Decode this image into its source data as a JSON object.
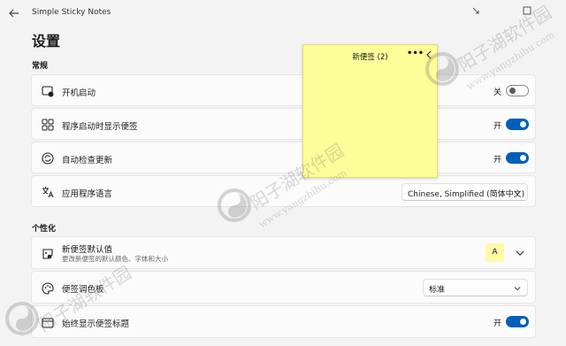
{
  "window": {
    "app_title": "Simple Sticky Notes"
  },
  "page": {
    "title": "设置"
  },
  "sections": {
    "general": "常规",
    "personalization": "个性化"
  },
  "rows": {
    "startup": {
      "label": "开机启动",
      "toggle_text": "关",
      "on": false
    },
    "show_notes": {
      "label": "程序启动时显示便签",
      "toggle_text": "开",
      "on": true
    },
    "auto_update": {
      "label": "自动检查更新",
      "toggle_text": "开",
      "on": true
    },
    "language": {
      "label": "应用程序语言",
      "value": "Chinese, Simplified (简体中文)"
    },
    "default_note": {
      "label": "新便签默认值",
      "sublabel": "更改新便签的默认颜色、字体和大小",
      "preview": "A"
    },
    "palette": {
      "label": "便签调色板",
      "value": "标准"
    },
    "always_title": {
      "label": "始终显示便签标题",
      "toggle_text": "开",
      "on": true
    }
  },
  "sticky_note": {
    "title": "新便签 (2)",
    "more": "•••",
    "color": "#fdfd99"
  },
  "watermark": {
    "brand": "阳子湖软件园",
    "url": "www.yangzhihu.com"
  },
  "colors": {
    "accent": "#005fb8",
    "background": "#f3f3f3",
    "card": "#fbfbfb"
  },
  "icons": [
    "back-arrow-icon",
    "minimize-icon",
    "maximize-icon",
    "startup-icon",
    "grid-icon",
    "update-icon",
    "language-icon",
    "note-default-icon",
    "palette-icon",
    "title-bar-icon",
    "chevron-down-icon",
    "more-icon",
    "expand-arrow-icon"
  ]
}
